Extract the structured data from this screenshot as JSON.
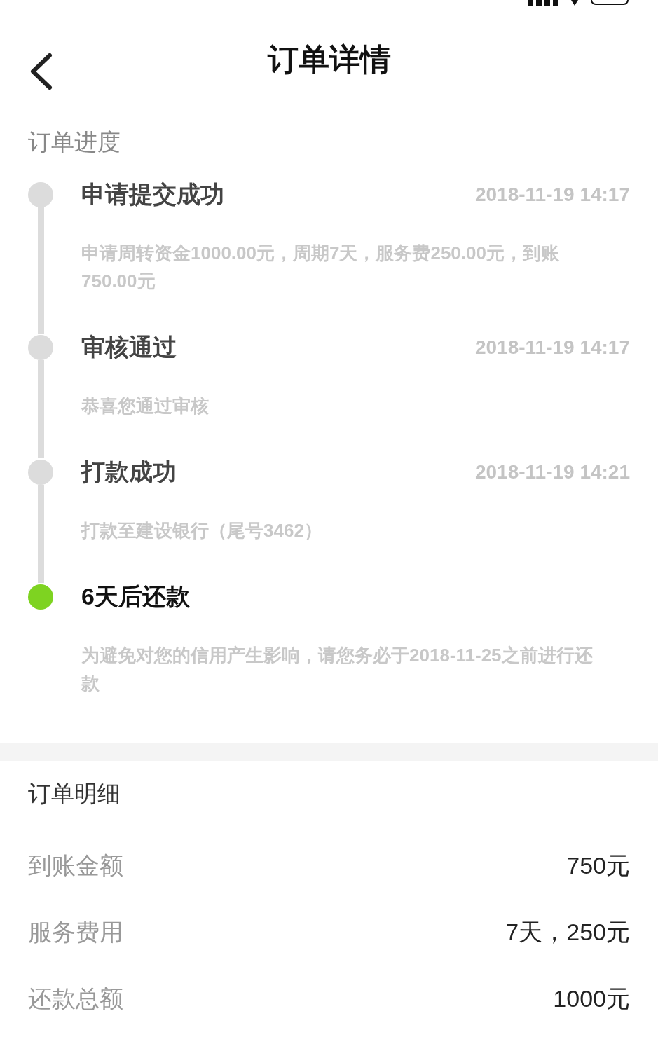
{
  "header": {
    "title": "订单详情"
  },
  "progress": {
    "title": "订单进度",
    "steps": [
      {
        "title": "申请提交成功",
        "time": "2018-11-19 14:17",
        "description": "申请周转资金1000.00元，周期7天，服务费250.00元，到账750.00元",
        "active": false
      },
      {
        "title": "审核通过",
        "time": "2018-11-19 14:17",
        "description": "恭喜您通过审核",
        "active": false
      },
      {
        "title": "打款成功",
        "time": "2018-11-19 14:21",
        "description": "打款至建设银行（尾号3462）",
        "active": false
      },
      {
        "title": "6天后还款",
        "description": "为避免对您的信用产生影响，请您务必于2018-11-25之前进行还款",
        "active": true
      }
    ]
  },
  "details": {
    "title": "订单明细",
    "rows": [
      {
        "label": "到账金额",
        "value": "750元"
      },
      {
        "label": "服务费用",
        "value": "7天，250元"
      },
      {
        "label": "还款总额",
        "value": "1000元"
      }
    ]
  }
}
